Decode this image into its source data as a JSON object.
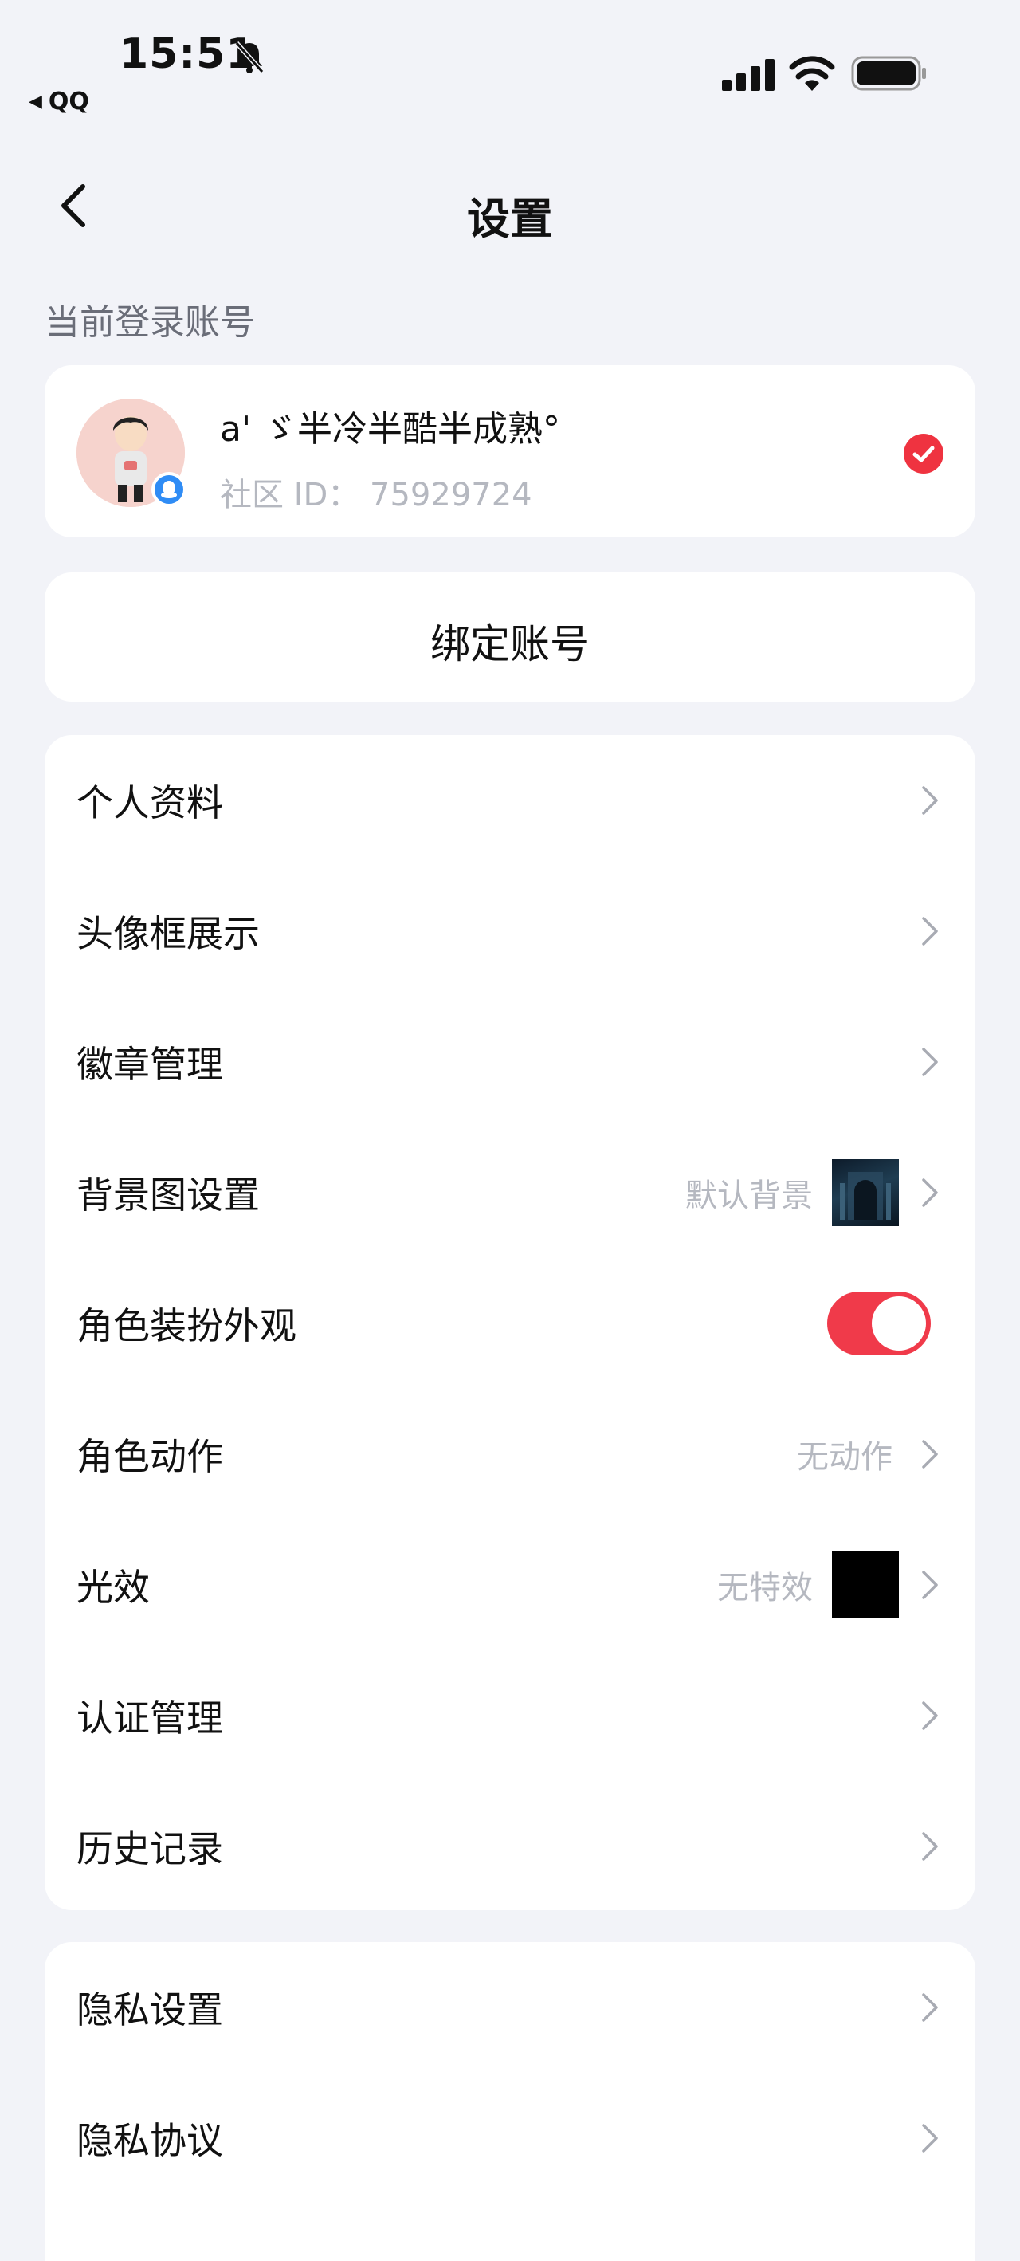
{
  "status_bar": {
    "time": "15:51",
    "back_app": "QQ"
  },
  "nav": {
    "title": "设置"
  },
  "account": {
    "section_label": "当前登录账号",
    "name": "a' ゞ半冷半酷半成熟°",
    "id_text": "社区 ID： 75929724"
  },
  "bind": {
    "label": "绑定账号"
  },
  "menu": {
    "items": [
      {
        "label": "个人资料"
      },
      {
        "label": "头像框展示"
      },
      {
        "label": "徽章管理"
      },
      {
        "label": "背景图设置",
        "value": "默认背景"
      },
      {
        "label": "角色装扮外观",
        "toggle_on": true
      },
      {
        "label": "角色动作",
        "value": "无动作"
      },
      {
        "label": "光效",
        "value": "无特效"
      },
      {
        "label": "认证管理"
      },
      {
        "label": "历史记录"
      }
    ]
  },
  "menu2": {
    "items": [
      {
        "label": "隐私设置"
      },
      {
        "label": "隐私协议"
      }
    ]
  },
  "colors": {
    "accent": "#ef3340",
    "background": "#f2f3f8",
    "card": "#ffffff",
    "muted": "#b5b8c0"
  }
}
